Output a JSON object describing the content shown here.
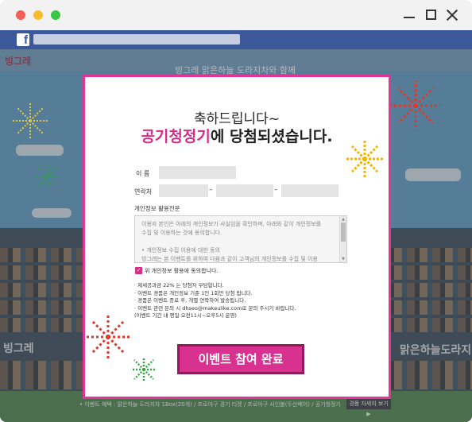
{
  "window": {
    "controls": [
      "minimize-icon",
      "maximize-icon",
      "close-icon"
    ]
  },
  "browser": {
    "site_icon": "facebook-icon",
    "site_icon_glyph": "f"
  },
  "background_page": {
    "logo": "빙그레",
    "headline": "빙그레 맑은하늘 도라지차와 함께",
    "side_logo": "빙그레",
    "side_text": "맑은하늘도라지",
    "footer_text": "• 이벤트 혜택 : 맑은하늘 도라지차 1Box(20개) / 프로야구 경기 티켓 / 프로야구 사인볼(두산베어) / 공기청정기",
    "footer_button": "경품 자세히 보기 ▶"
  },
  "modal": {
    "headline_line1": "축하드립니다~",
    "headline_prize": "공기청정기",
    "headline_suffix": "에 당첨되셨습니다.",
    "name_label": "이   름",
    "contact_label": "연락처",
    "phone_separator": "–",
    "terms_title": "개인정보 활용전문",
    "terms_lines": [
      "이용자 본인은 아래의 개인정보가 사실임을 확인하며, 아래와 같이 개인정보를",
      "수집 및 이용하는 것에 동의합니다.",
      "",
      "• 개인정보 수집 이용에 대한 동의",
      "빙그레는 본 이벤트를 위하여 다음과 같이 고객님의 개인정보를 수집 및 이용"
    ],
    "consent_label": "위 개인정보 활용에 동의합니다.",
    "notes": [
      "· 제세공과금 22% 는 당첨자 부담합니다.",
      "· 이벤트 경품은 개인정보 기준 1인 1회만 당첨 됩니다.",
      "· 경품은 이벤트 종료 후, 개별 연락하여 발송됩니다.",
      "· 이벤트 관련 문의 시 dhseo@makeulike.com로 문의 주시기 바랍니다.",
      "  (이벤트 기간 내 평일 오전11시~오후5시 운영)"
    ],
    "submit_label": "이벤트 참여 완료"
  },
  "colors": {
    "accent_pink": "#d72d89",
    "modal_border": "#e43596",
    "facebook_blue": "#3b5998",
    "firework_red": "#e0392e",
    "firework_yellow": "#f4b400",
    "firework_green": "#2eaa3d"
  }
}
